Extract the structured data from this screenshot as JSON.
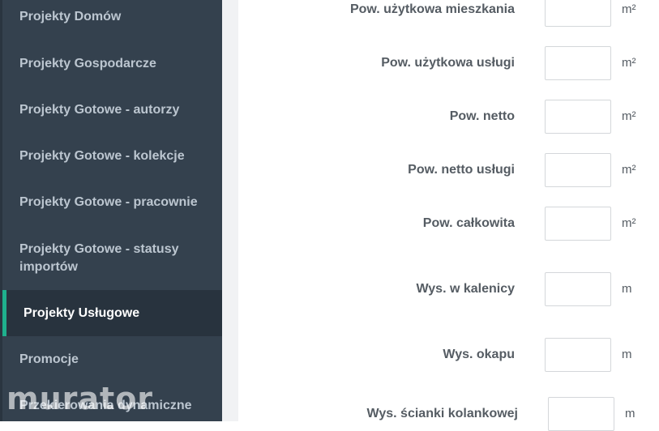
{
  "sidebar": {
    "items": [
      {
        "label": "Projekty Domów"
      },
      {
        "label": "Projekty Gospodarcze"
      },
      {
        "label": "Projekty Gotowe - autorzy"
      },
      {
        "label": "Projekty Gotowe - kolekcje"
      },
      {
        "label": "Projekty Gotowe - pracownie"
      },
      {
        "label": "Projekty Gotowe - statusy importów"
      },
      {
        "label": "Projekty Usługowe",
        "active": true
      },
      {
        "label": "Promocje"
      },
      {
        "label": "Przekierowania dynamiczne"
      }
    ],
    "watermark": "murator",
    "active_accent": "#1fb08d"
  },
  "form": {
    "fields": [
      {
        "label": "Pow. użytkowa mieszkania",
        "value": "",
        "unit": "m²"
      },
      {
        "label": "Pow. użytkowa usługi",
        "value": "",
        "unit": "m²"
      },
      {
        "label": "Pow. netto",
        "value": "",
        "unit": "m²"
      },
      {
        "label": "Pow. netto usługi",
        "value": "",
        "unit": "m²"
      },
      {
        "label": "Pow. całkowita",
        "value": "",
        "unit": "m²"
      },
      {
        "label": "Wys. w kalenicy",
        "value": "",
        "unit": "m"
      },
      {
        "label": "Wys. okapu",
        "value": "",
        "unit": "m"
      },
      {
        "label": "Wys. ścianki kolankowej",
        "value": "",
        "unit": "m"
      }
    ]
  }
}
